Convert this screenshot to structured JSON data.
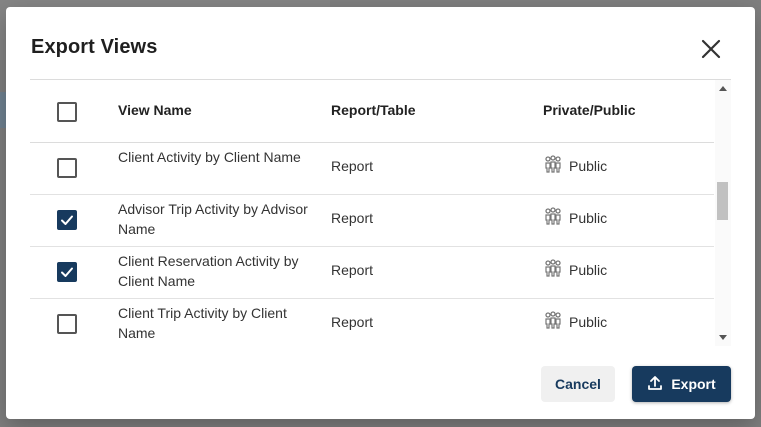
{
  "dialog": {
    "title": "Export Views",
    "close_icon": "close-icon"
  },
  "table": {
    "columns": [
      "View Name",
      "Report/Table",
      "Private/Public"
    ],
    "rows": [
      {
        "name": "Client Activity by Client Name",
        "type": "Report",
        "visibility": "Public",
        "checked": false
      },
      {
        "name": "Advisor Trip Activity by Advisor Name",
        "type": "Report",
        "visibility": "Public",
        "checked": true
      },
      {
        "name": "Client Reservation Activity by Client Name",
        "type": "Report",
        "visibility": "Public",
        "checked": true
      },
      {
        "name": "Client Trip Activity by Client Name",
        "type": "Report",
        "visibility": "Public",
        "checked": false
      }
    ],
    "header_checked": false
  },
  "footer": {
    "cancel_label": "Cancel",
    "export_label": "Export",
    "export_icon": "upload-icon"
  },
  "colors": {
    "primary": "#173a5e",
    "cancel_bg": "#f0f0f0"
  }
}
